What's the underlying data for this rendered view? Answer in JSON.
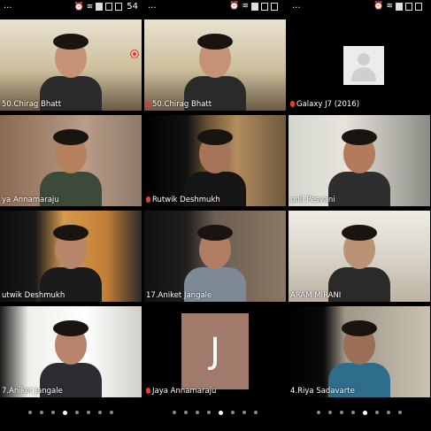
{
  "columns": [
    {
      "status": {
        "left": "...",
        "battery": "54"
      },
      "tiles": [
        {
          "name": "50.Chirag Bhatt",
          "mic": false,
          "style": "v-room"
        },
        {
          "name": "ya Annamaraju",
          "mic": false,
          "style": "v-girl"
        },
        {
          "name": "utwik Deshmukh",
          "mic": false,
          "style": "v-curtain"
        },
        {
          "name": "7.Aniket Jangale",
          "mic": false,
          "style": "v-suit"
        }
      ],
      "pager_active": 3
    },
    {
      "status": {
        "left": "...",
        "battery": ""
      },
      "tiles": [
        {
          "name": "50.Chirag Bhatt",
          "mic": true,
          "style": "v-room"
        },
        {
          "name": "Rutwik Deshmukh",
          "mic": true,
          "style": "v-curtain2"
        },
        {
          "name": "17.Aniket Jangale",
          "mic": false,
          "style": "v-wall"
        },
        {
          "name": "Jaya Annamaraju",
          "mic": true,
          "style": "initial",
          "initial": "J"
        }
      ],
      "pager_active": 4
    },
    {
      "status": {
        "left": "...",
        "battery": ""
      },
      "tiles": [
        {
          "name": "Galaxy J7 (2016)",
          "mic": true,
          "style": "placeholder"
        },
        {
          "name": "unil Pesvani",
          "mic": false,
          "style": "v-beard"
        },
        {
          "name": "ARAM MIRANI",
          "mic": false,
          "style": "v-glasses"
        },
        {
          "name": "4.Riya Sadavarte",
          "mic": false,
          "style": "v-phone"
        }
      ],
      "pager_active": 4
    }
  ]
}
